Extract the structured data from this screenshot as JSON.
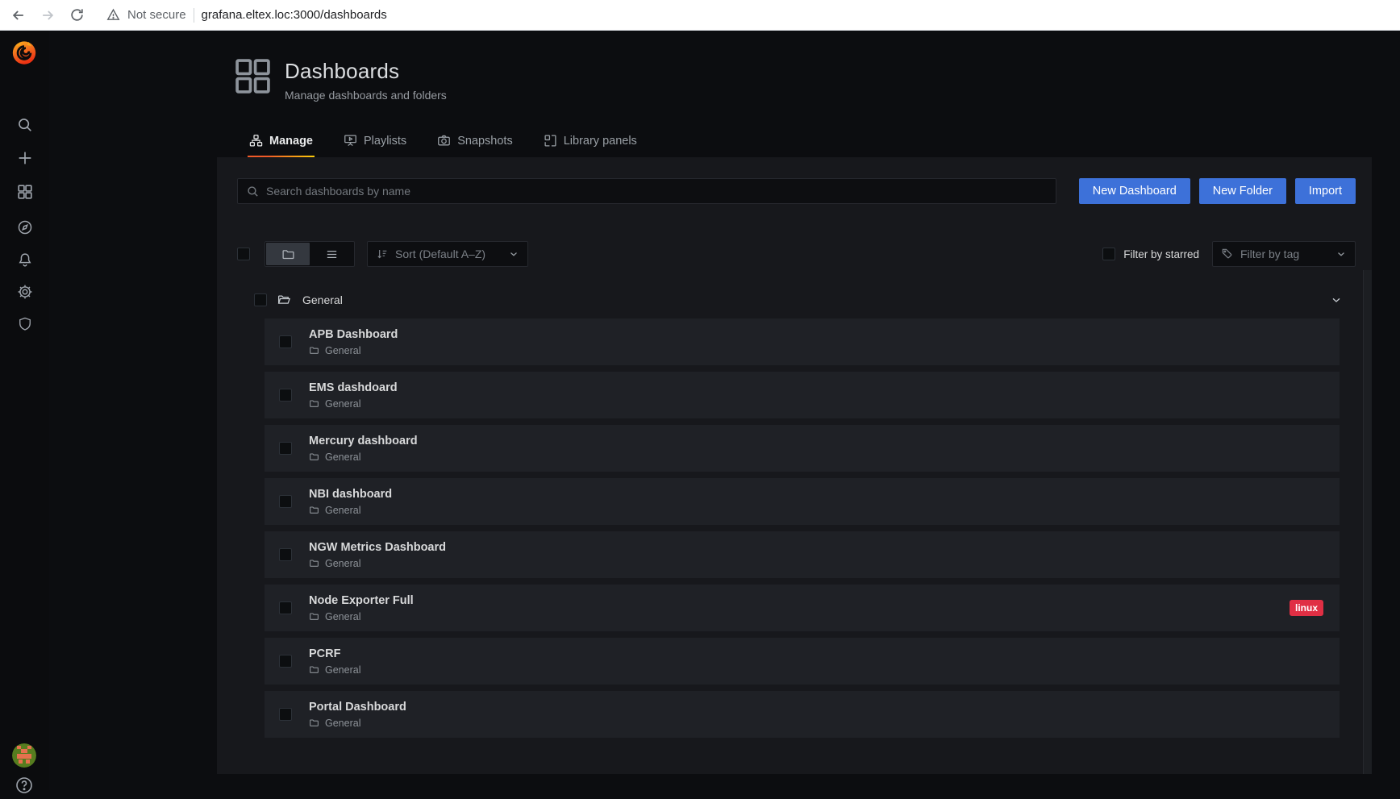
{
  "browser": {
    "security_label": "Not secure",
    "url": "grafana.eltex.loc:3000/dashboards"
  },
  "sidebar": {
    "items": [
      "grafana-logo",
      "search-icon",
      "create-plus-icon",
      "dashboards-grid-icon",
      "explore-compass-icon",
      "alerting-bell-icon",
      "configuration-gear-icon",
      "server-admin-shield-icon",
      "user-avatar",
      "help-icon"
    ]
  },
  "header": {
    "title": "Dashboards",
    "subtitle": "Manage dashboards and folders"
  },
  "tabs": [
    {
      "label": "Manage",
      "active": true
    },
    {
      "label": "Playlists",
      "active": false
    },
    {
      "label": "Snapshots",
      "active": false
    },
    {
      "label": "Library panels",
      "active": false
    }
  ],
  "toolbar": {
    "search_placeholder": "Search dashboards by name",
    "new_dashboard_label": "New Dashboard",
    "new_folder_label": "New Folder",
    "import_label": "Import"
  },
  "filters": {
    "sort_label": "Sort (Default A–Z)",
    "starred_label": "Filter by starred",
    "tag_placeholder": "Filter by tag"
  },
  "folder": {
    "name": "General"
  },
  "dashboards": [
    {
      "title": "APB Dashboard",
      "folder": "General",
      "tags": []
    },
    {
      "title": "EMS dashdoard",
      "folder": "General",
      "tags": []
    },
    {
      "title": "Mercury dashboard",
      "folder": "General",
      "tags": []
    },
    {
      "title": "NBI dashboard",
      "folder": "General",
      "tags": []
    },
    {
      "title": "NGW Metrics Dashboard",
      "folder": "General",
      "tags": []
    },
    {
      "title": "Node Exporter Full",
      "folder": "General",
      "tags": [
        "linux"
      ]
    },
    {
      "title": "PCRF",
      "folder": "General",
      "tags": []
    },
    {
      "title": "Portal Dashboard",
      "folder": "General",
      "tags": []
    }
  ],
  "colors": {
    "primary_button": "#3d71d9",
    "tag_red": "#e02f44",
    "tab_underline_start": "#f05a28",
    "tab_underline_end": "#fbca0a",
    "panel_bg": "#17181c",
    "row_bg": "#1f2126",
    "sidebar_bg": "#0b0c0e"
  }
}
